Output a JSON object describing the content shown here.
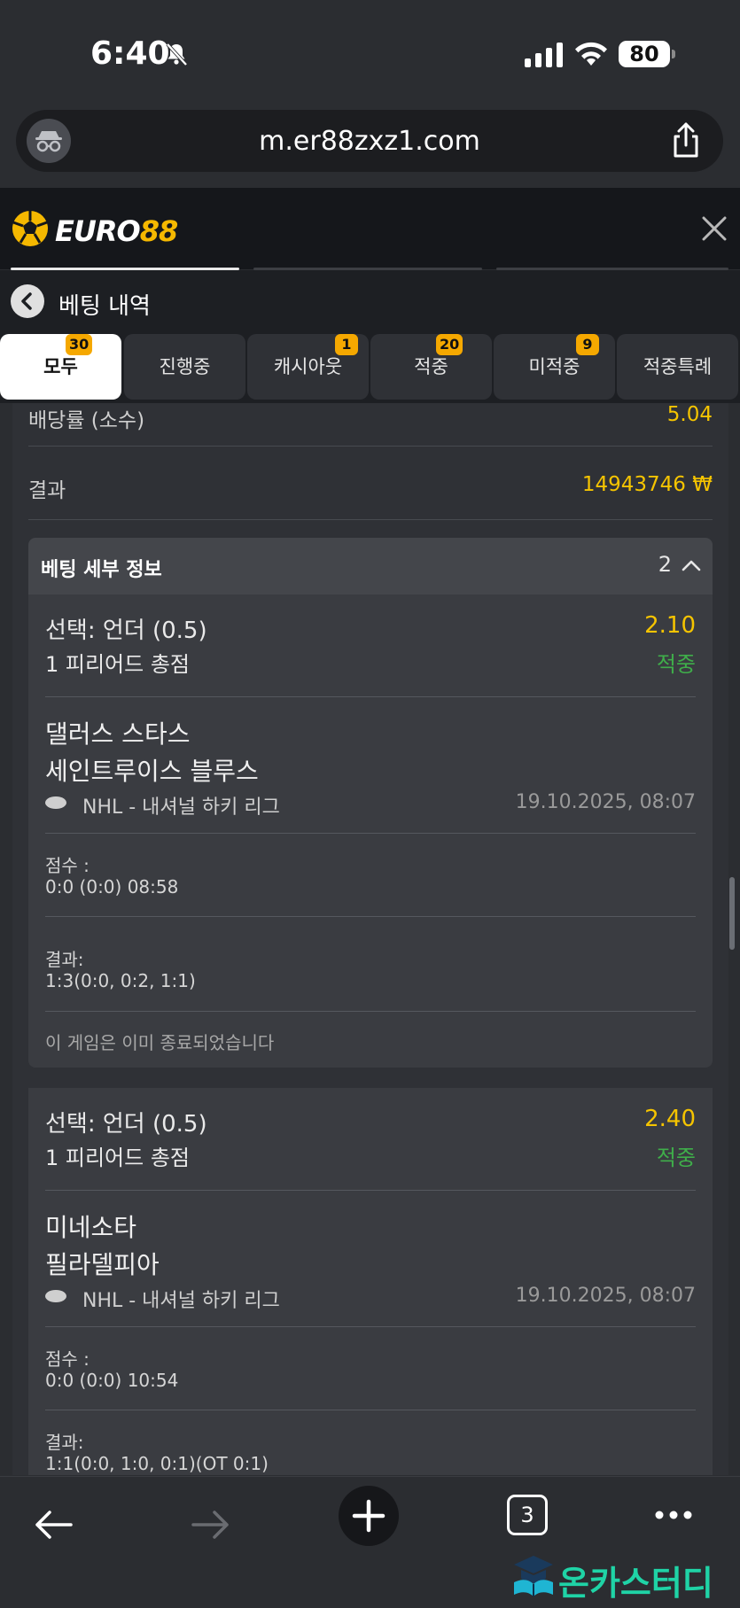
{
  "status_bar": {
    "time": "6:40",
    "battery": "80"
  },
  "browser": {
    "url": "m.er88zxz1.com",
    "tab_count": "3"
  },
  "site": {
    "logo_text_white": "EURO",
    "logo_text_yellow": "88"
  },
  "page": {
    "title": "베팅 내역"
  },
  "tabs": [
    {
      "label": "모두",
      "badge": "30",
      "active": true
    },
    {
      "label": "진행중",
      "badge": "",
      "active": false
    },
    {
      "label": "캐시아웃",
      "badge": "1",
      "active": false
    },
    {
      "label": "적중",
      "badge": "20",
      "active": false
    },
    {
      "label": "미적중",
      "badge": "9",
      "active": false
    },
    {
      "label": "적중특례",
      "badge": "",
      "active": false
    }
  ],
  "summary": {
    "odds_label": "배당률 (소수)",
    "odds_value": "5.04",
    "result_label": "결과",
    "result_value": "14943746 ₩"
  },
  "details": {
    "title": "베팅 세부 정보",
    "count": "2",
    "bets": [
      {
        "selection": "선택: 언더 (0.5)",
        "market": "1 피리어드 총점",
        "odds": "2.10",
        "status": "적중",
        "home": "댈러스 스타스",
        "away": "세인트루이스 블루스",
        "league": "NHL - 내셔널 하키 리그",
        "date": "19.10.2025, 08:07",
        "score_label": "점수 :",
        "score_value": "0:0 (0:0) 08:58",
        "result_label": "결과:",
        "result_value": "1:3(0:0, 0:2, 1:1)",
        "ended_note": "이 게임은 이미 종료되었습니다"
      },
      {
        "selection": "선택: 언더 (0.5)",
        "market": "1 피리어드 총점",
        "odds": "2.40",
        "status": "적중",
        "home": "미네소타",
        "away": "필라델피아",
        "league": "NHL - 내셔널 하키 리그",
        "date": "19.10.2025, 08:07",
        "score_label": "점수 :",
        "score_value": "0:0 (0:0) 10:54",
        "result_label": "결과:",
        "result_value": "1:1(0:0, 1:0, 0:1)(OT 0:1)"
      }
    ]
  },
  "watermark": {
    "text": "온카스터디"
  },
  "colors": {
    "accent": "#f5c400",
    "win": "#3fae4a",
    "badge": "#f5a800",
    "background": "#2b2d31"
  }
}
